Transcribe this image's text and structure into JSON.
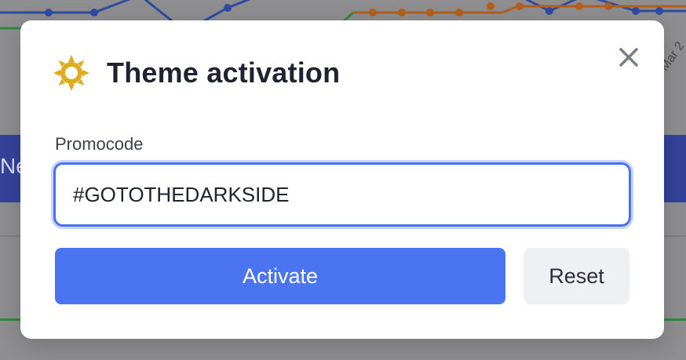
{
  "dialog": {
    "title": "Theme activation",
    "icon": "sun-icon",
    "close_icon": "close-icon"
  },
  "form": {
    "promocode_label": "Promocode",
    "promocode_value": "#GOTOTHEDARKSIDE",
    "activate_label": "Activate",
    "reset_label": "Reset"
  },
  "background": {
    "band_text": "Ne",
    "axis_label_fragment": "Mar 2"
  },
  "colors": {
    "primary": "#4a74f0",
    "icon": "#e0ac1f",
    "title_text": "#1f2230",
    "secondary_button": "#eff0f4"
  }
}
